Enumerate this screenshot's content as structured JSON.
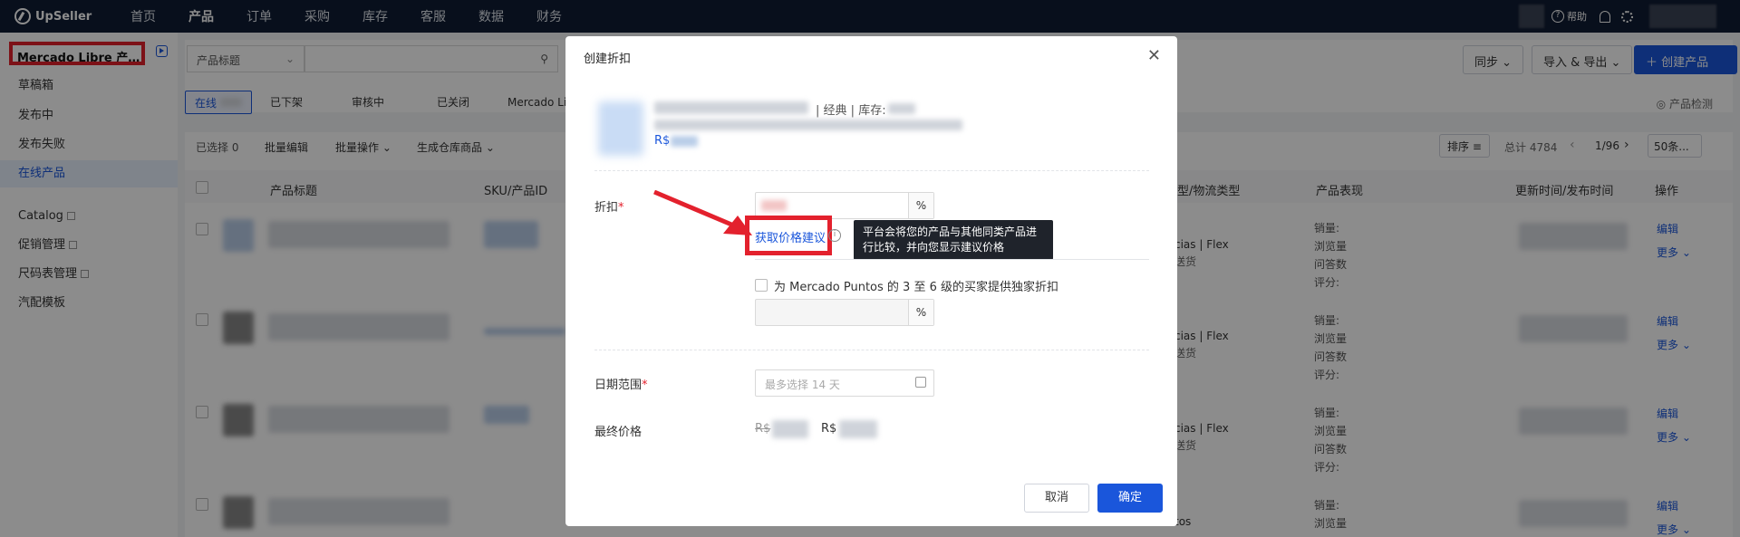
{
  "topbar": {
    "logo": "UpSeller",
    "nav": [
      "首页",
      "产品",
      "订单",
      "采购",
      "库存",
      "客服",
      "数据",
      "财务"
    ],
    "help": "帮助"
  },
  "sidebar": {
    "shop": "Mercado Libre 产…",
    "items": [
      {
        "label": "草稿箱"
      },
      {
        "label": "发布中"
      },
      {
        "label": "发布失败"
      },
      {
        "label": "在线产品"
      },
      {
        "label": "Catalog"
      },
      {
        "label": "促销管理"
      },
      {
        "label": "尺码表管理"
      },
      {
        "label": "汽配模板"
      }
    ]
  },
  "toolbar": {
    "search_field": "产品标题",
    "sync": "同步",
    "import_export": "导入 & 导出",
    "create": "创建产品"
  },
  "tabs": [
    "在线",
    "已下架",
    "审核中",
    "已关闭",
    "Mercado Libr"
  ],
  "product_check": "产品检测",
  "bulk": {
    "selected": "已选择 0",
    "edit": "批量编辑",
    "ops": "批量操作",
    "gen": "生成仓库商品"
  },
  "pager": {
    "sort": "排序",
    "total": "总计 4784",
    "page": "1/96",
    "size": "50条..."
  },
  "table": {
    "headers": [
      "产品标题",
      "SKU/产品ID",
      "类型/物流类型",
      "产品表现",
      "更新时间/发布时间",
      "操作"
    ],
    "rows": [
      {
        "type": "cias | Flex",
        "type2": "送货",
        "stats": [
          "销量:",
          "浏览量",
          "问答数",
          "评分:"
        ],
        "edit": "编辑",
        "more": "更多"
      },
      {
        "type": "cias | Flex",
        "type2": "送货",
        "stats": [
          "销量:",
          "浏览量",
          "问答数",
          "评分:"
        ],
        "edit": "编辑",
        "more": "更多"
      },
      {
        "type": "cias | Flex",
        "type2": "送货",
        "stats": [
          "销量:",
          "浏览量",
          "问答数",
          "评分:"
        ],
        "edit": "编辑",
        "more": "更多"
      },
      {
        "type": "tos",
        "type2": "",
        "stats": [
          "销量:",
          "浏览量"
        ],
        "edit": "编辑",
        "more": "更多"
      }
    ]
  },
  "modal": {
    "title": "创建折扣",
    "product": {
      "listing": "经典",
      "stock": "库存:",
      "price_currency": "R$"
    },
    "discount_label": "折扣",
    "suggest_link": "获取价格建议",
    "tooltip": "平台会将您的产品与其他同类产品进行比较，并向您显示建议价格",
    "puntos_label": "为 Mercado Puntos 的 3 至 6 级的买家提供独家折扣",
    "date_label": "日期范围",
    "date_placeholder": "最多选择 14 天",
    "final_price_label": "最终价格",
    "currency": "R$",
    "percent": "%",
    "cancel": "取消",
    "confirm": "确定"
  }
}
